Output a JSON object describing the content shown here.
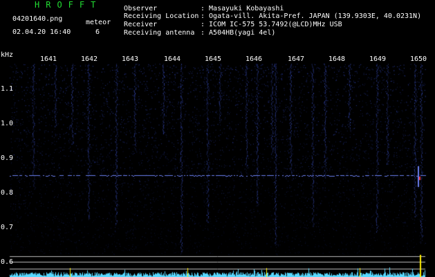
{
  "header": {
    "brand": "HROFFT",
    "filename": "04201640.png",
    "meteor_label": "meteor",
    "datetime": "02.04.20 16:40",
    "meteor_count": "6",
    "info": [
      {
        "label": "Observer",
        "value": ": Masayuki Kobayashi"
      },
      {
        "label": "Receiving Location",
        "value": ": Ogata-vill. Akita-Pref. JAPAN (139.9303E, 40.0231N)"
      },
      {
        "label": "Receiver",
        "value": ": ICOM IC-575 53.7492(@LCD)MHz USB"
      },
      {
        "label": "Receiving antenna",
        "value": ": A504HB(yagi 4el)"
      }
    ]
  },
  "axes": {
    "y_unit": "kHz",
    "x_ticks": [
      "1641",
      "1642",
      "1643",
      "1644",
      "1645",
      "1646",
      "1647",
      "1648",
      "1649",
      "1650"
    ],
    "y_ticks": [
      "1.1",
      "1.0",
      "0.9",
      "0.8",
      "0.7",
      "0.6"
    ]
  },
  "colors": {
    "background": "#000000",
    "brand": "#22dd33",
    "text": "#ffffff",
    "signal": "#3a52d8",
    "carrier": "#6b7ff0",
    "meteor_head": "#ff3030",
    "level_bars": "#58d8ff",
    "level_peak": "#ffee00"
  }
}
